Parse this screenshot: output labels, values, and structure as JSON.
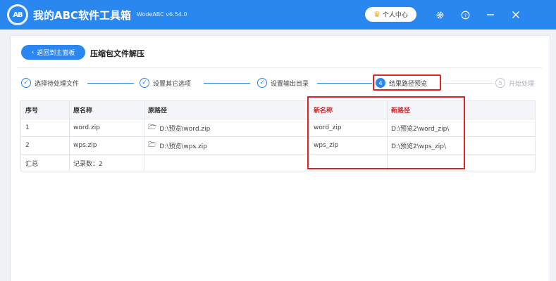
{
  "app": {
    "logo_text": "AB",
    "title": "我的ABC软件工具箱",
    "version": "WodeABC v6.54.0",
    "user_center": "个人中心"
  },
  "icons": {
    "logo": "app-logo",
    "crown": "crown-icon",
    "settings": "gear-icon",
    "help": "help-icon",
    "minimize": "minimize-icon",
    "close": "close-icon"
  },
  "page": {
    "back_label": "返回到主面板",
    "title": "压缩包文件解压"
  },
  "steps": [
    {
      "num": "✓",
      "label": "选择待处理文件",
      "state": "done"
    },
    {
      "num": "✓",
      "label": "设置其它选项",
      "state": "done"
    },
    {
      "num": "✓",
      "label": "设置输出目录",
      "state": "done"
    },
    {
      "num": "4",
      "label": "结果路径预览",
      "state": "active"
    },
    {
      "num": "5",
      "label": "开始处理",
      "state": "pending"
    }
  ],
  "table": {
    "columns": [
      "序号",
      "原名称",
      "原路径",
      "新名称",
      "新路径"
    ],
    "rows": [
      {
        "index": "1",
        "name": "word.zip",
        "path": "D:\\预览\\word.zip",
        "new_name": "word_zip",
        "new_path": "D:\\预览2\\word_zip\\"
      },
      {
        "index": "2",
        "name": "wps.zip",
        "path": "D:\\预览\\wps.zip",
        "new_name": "wps_zip",
        "new_path": "D:\\预览2\\wps_zip\\"
      }
    ],
    "summary": {
      "label": "汇总",
      "count_text": "记录数：2"
    }
  },
  "colors": {
    "primary": "#2b87f0",
    "highlight": "#e02424"
  }
}
